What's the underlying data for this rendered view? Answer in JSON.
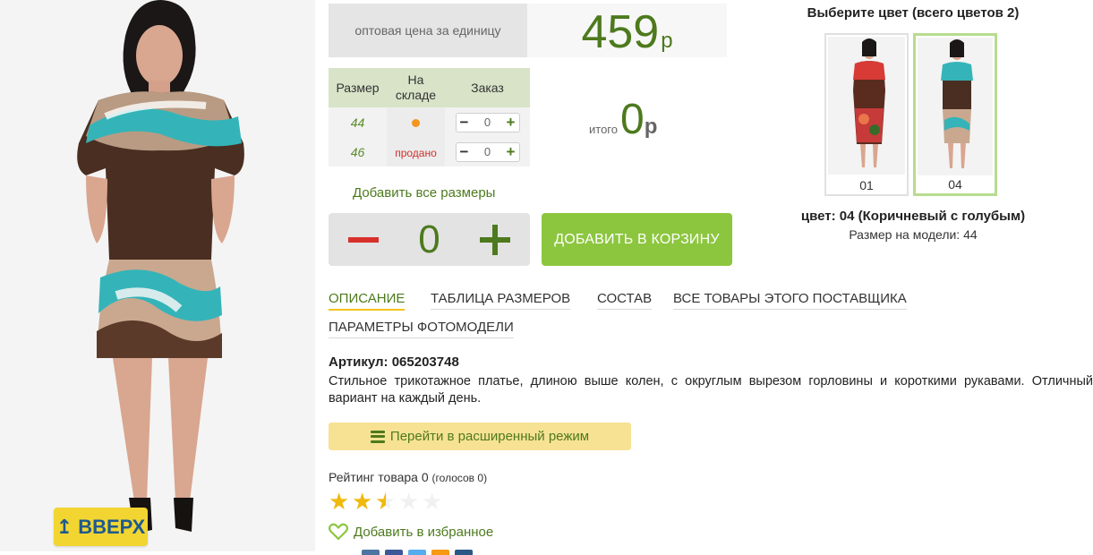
{
  "photo": {
    "up_button": {
      "label": "ВВЕРХ",
      "icon": "arrow-up-icon"
    }
  },
  "price": {
    "label": "оптовая цена за единицу",
    "value": "459",
    "currency": "р"
  },
  "size_table": {
    "headers": {
      "size": "Размер",
      "stock": "На складе",
      "order": "Заказ"
    },
    "rows": [
      {
        "size": "44",
        "stock": "",
        "stock_status": "in-stock-dot",
        "qty": "0"
      },
      {
        "size": "46",
        "stock": "продано",
        "stock_status": "sold",
        "qty": "0"
      }
    ]
  },
  "total": {
    "label": "итого",
    "value": "0",
    "currency": "р"
  },
  "add_all_sizes": "Добавить все размеры",
  "quantity": {
    "value": "0"
  },
  "cart_button": "ДОБАВИТЬ В КОРЗИНУ",
  "colors": {
    "title": "Выберите цвет (всего цветов 2)",
    "options": [
      {
        "code": "01",
        "selected": false
      },
      {
        "code": "04",
        "selected": true
      }
    ],
    "selected_name": "цвет: 04 (Коричневый с голубым)",
    "model_size": "Размер на модели: 44"
  },
  "tabs": [
    {
      "label": "ОПИСАНИЕ",
      "active": true
    },
    {
      "label": "ТАБЛИЦА РАЗМЕРОВ",
      "active": false
    },
    {
      "label": "СОСТАВ",
      "active": false
    },
    {
      "label": "ВСЕ ТОВАРЫ ЭТОГО ПОСТАВЩИКА",
      "active": false
    },
    {
      "label": "ПАРАМЕТРЫ ФОТОМОДЕЛИ",
      "active": false
    }
  ],
  "description": {
    "sku": "Артикул: 065203748",
    "text": "Стильное трикотажное платье, длиною выше колен, с округлым вырезом горловины и короткими рукавами. Отличный вариант на каждый день."
  },
  "advanced_mode": {
    "label": "Перейти в расширенный режим",
    "icon": "list-icon"
  },
  "rating": {
    "label": "Рейтинг товара 0",
    "votes": "(голосов 0)",
    "stars_filled": 2.5,
    "stars_total": 5
  },
  "favorite": {
    "label": "Добавить в избранное",
    "icon": "heart-icon"
  },
  "colors_palette": {
    "accent_green": "#4d7a1d",
    "cart_green": "#8cc63e",
    "yellow": "#f2d531",
    "sold_red": "#d0302a",
    "star_gold": "#f0b90b"
  }
}
